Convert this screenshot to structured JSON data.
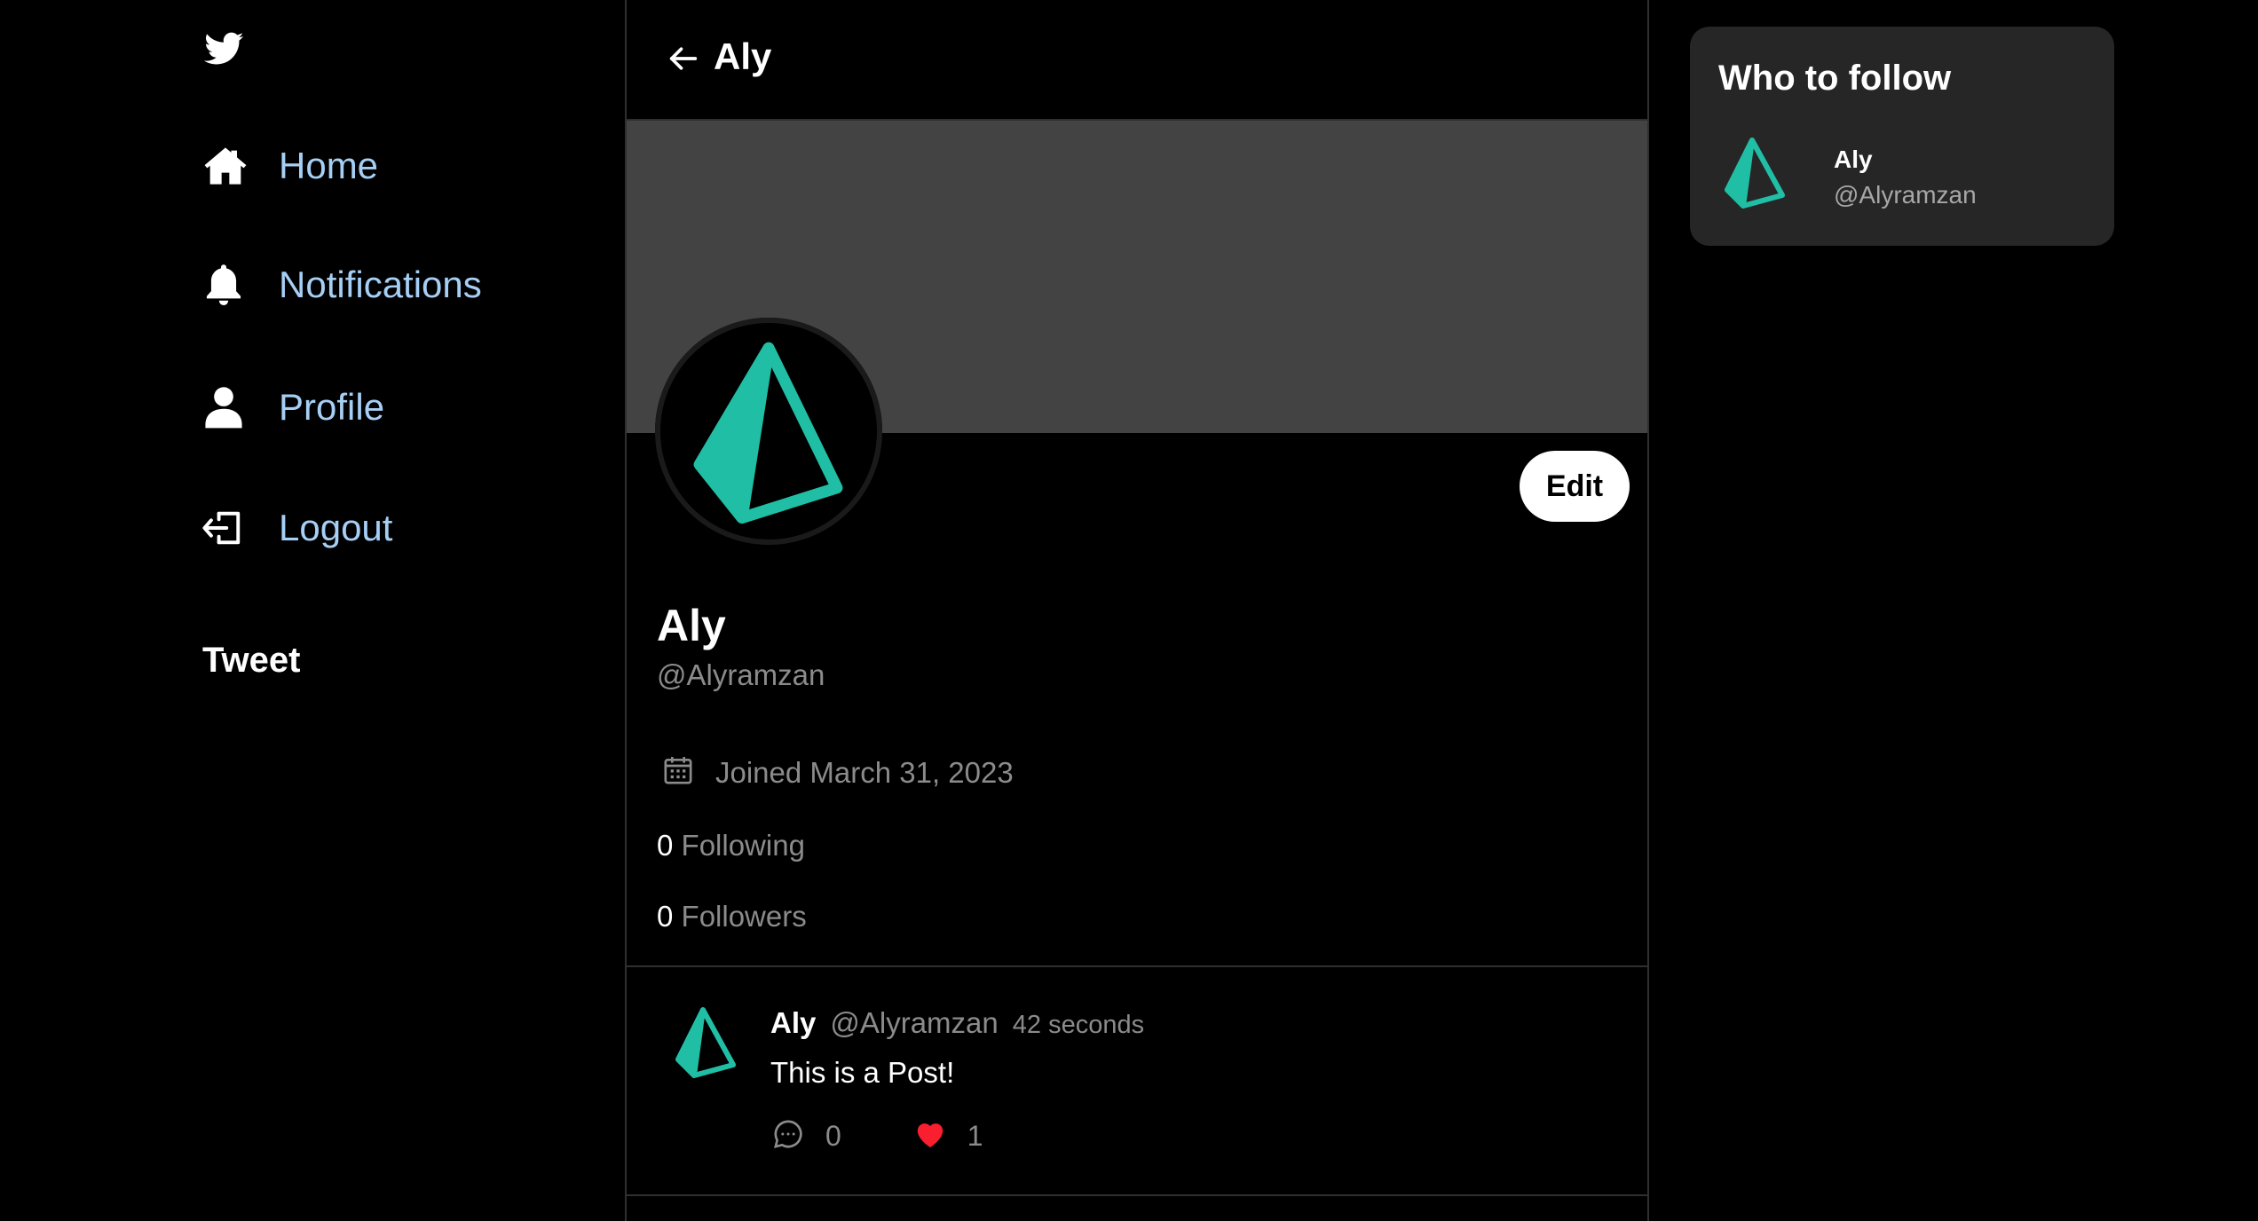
{
  "sidebar": {
    "logo_icon": "twitter-bird-icon",
    "items": [
      {
        "label": "Home",
        "icon": "home-icon"
      },
      {
        "label": "Notifications",
        "icon": "bell-icon"
      },
      {
        "label": "Profile",
        "icon": "user-icon"
      },
      {
        "label": "Logout",
        "icon": "logout-icon"
      }
    ],
    "tweet_label": "Tweet"
  },
  "header": {
    "back_icon": "arrow-left-icon",
    "title": "Aly"
  },
  "profile": {
    "name": "Aly",
    "handle": "@Alyramzan",
    "edit_label": "Edit",
    "joined": "Joined March 31, 2023",
    "following_count": "0",
    "following_label": "Following",
    "followers_count": "0",
    "followers_label": "Followers"
  },
  "posts": [
    {
      "author": "Aly",
      "handle": "@Alyramzan",
      "time": "42 seconds",
      "body": "This is a Post!",
      "comments": "0",
      "likes": "1"
    }
  ],
  "who_to_follow": {
    "title": "Who to follow",
    "users": [
      {
        "name": "Aly",
        "handle": "@Alyramzan"
      }
    ]
  },
  "colors": {
    "background": "#000000",
    "nav_text": "#a6cff5",
    "cover": "#434343",
    "muted": "#8b8b8b",
    "accent_teal": "#20bfa5",
    "like_red": "#f91f2f",
    "panel": "#262626"
  }
}
